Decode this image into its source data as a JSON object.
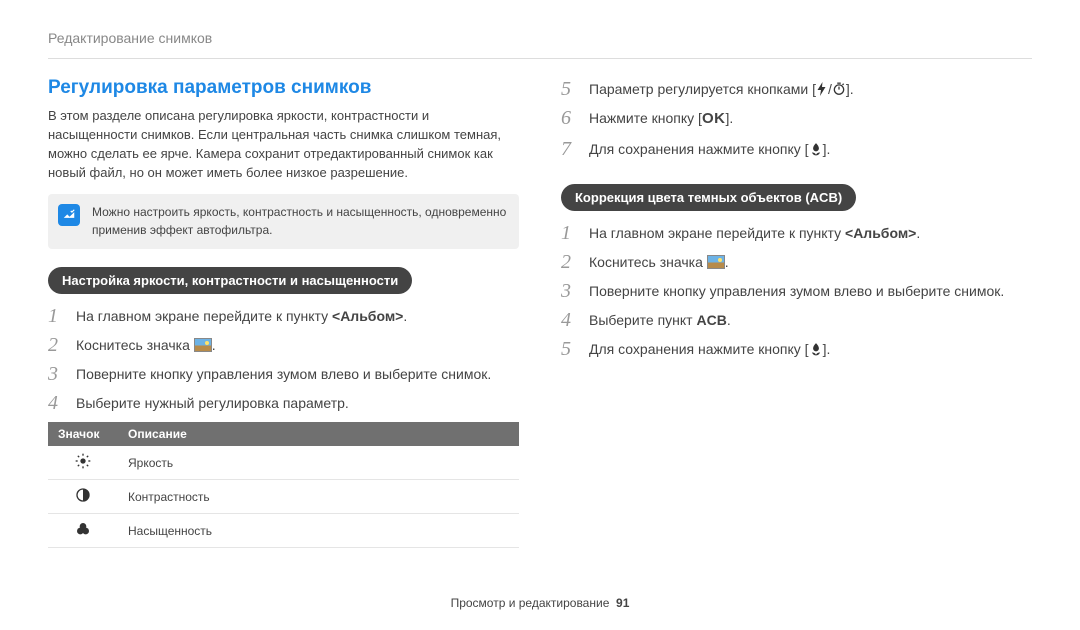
{
  "header": {
    "chapter": "Редактирование снимков"
  },
  "left": {
    "title": "Регулировка параметров снимков",
    "intro": "В этом разделе описана регулировка яркости, контрастности и насыщенности снимков. Если центральная часть снимка слишком темная, можно сделать ее ярче. Камера сохранит отредактированный снимок как новый файл, но он может иметь более низкое разрешение.",
    "note": "Можно настроить яркость, контрастность и насыщенность, одновременно применив эффект автофильтра.",
    "pill": "Настройка яркости, контрастности и насыщенности",
    "steps": {
      "s1a": "На главном экране перейдите к пункту ",
      "s1b": "<Альбом>",
      "s1c": ".",
      "s2a": "Коснитесь значка ",
      "s2b": ".",
      "s3": "Поверните кнопку управления зумом влево и выберите снимок.",
      "s4": "Выберите нужный регулировка параметр."
    },
    "table": {
      "h_icon": "Значок",
      "h_desc": "Описание",
      "r1": "Яркость",
      "r2": "Контрастность",
      "r3": "Насыщенность"
    }
  },
  "right": {
    "upper": {
      "s5a": "Параметр регулируется кнопками [",
      "s5b": "].",
      "s6a": "Нажмите кнопку [",
      "s6b": "].",
      "s7a": "Для сохранения нажмите кнопку [",
      "s7b": "]."
    },
    "pill": "Коррекция цвета темных объектов (ACB)",
    "lower": {
      "s1a": "На главном экране перейдите к пункту ",
      "s1b": "<Альбом>",
      "s1c": ".",
      "s2a": "Коснитесь значка ",
      "s2b": ".",
      "s3": "Поверните кнопку управления зумом влево и выберите снимок.",
      "s4a": "Выберите пункт ",
      "s4b": "ACB",
      "s4c": ".",
      "s5a": "Для сохранения нажмите кнопку [",
      "s5b": "]."
    }
  },
  "footer": {
    "label": "Просмотр и редактирование",
    "page": "91"
  }
}
